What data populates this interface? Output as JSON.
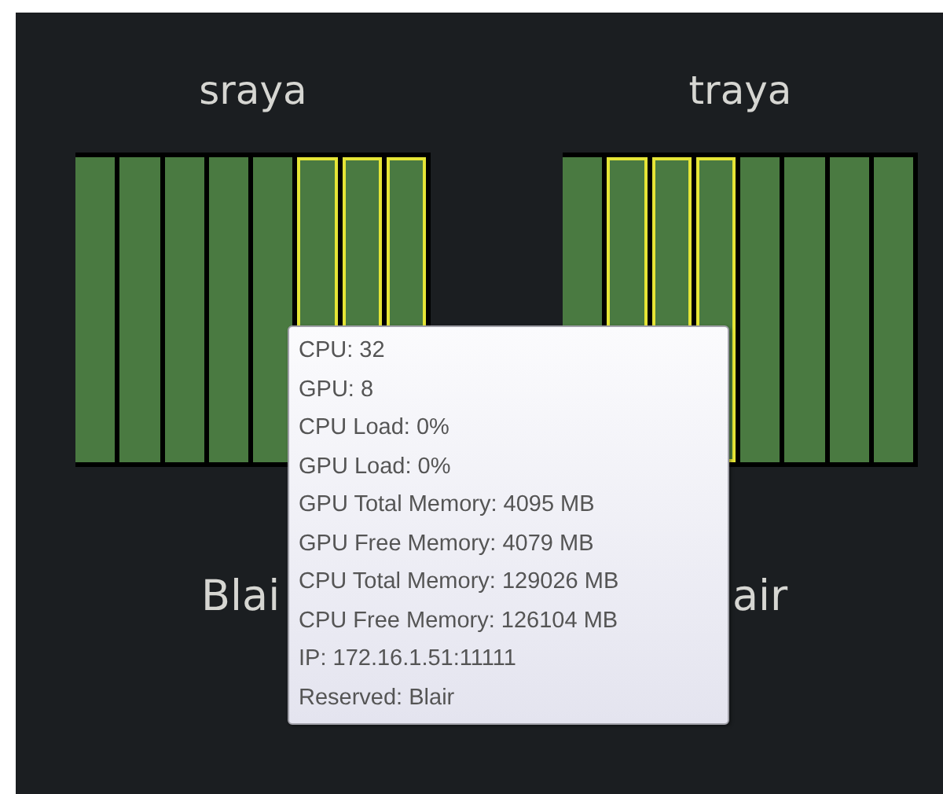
{
  "nodes": [
    {
      "name": "sraya",
      "reserved_label": "Blai",
      "cells": [
        {
          "selected": false
        },
        {
          "selected": false
        },
        {
          "selected": false
        },
        {
          "selected": false
        },
        {
          "selected": false
        },
        {
          "selected": true
        },
        {
          "selected": true
        },
        {
          "selected": true
        }
      ]
    },
    {
      "name": "traya",
      "reserved_label": "air",
      "cells": [
        {
          "selected": false
        },
        {
          "selected": true
        },
        {
          "selected": true
        },
        {
          "selected": true
        },
        {
          "selected": false
        },
        {
          "selected": false
        },
        {
          "selected": false
        },
        {
          "selected": false
        }
      ]
    }
  ],
  "tooltip": {
    "lines": [
      "CPU: 32",
      "GPU: 8",
      "CPU Load: 0%",
      "GPU Load: 0%",
      "GPU Total Memory: 4095 MB",
      "GPU Free Memory: 4079 MB",
      "CPU Total Memory: 129026 MB",
      "CPU Free Memory: 126104 MB",
      "IP: 172.16.1.51:11111",
      "Reserved: Blair"
    ]
  }
}
